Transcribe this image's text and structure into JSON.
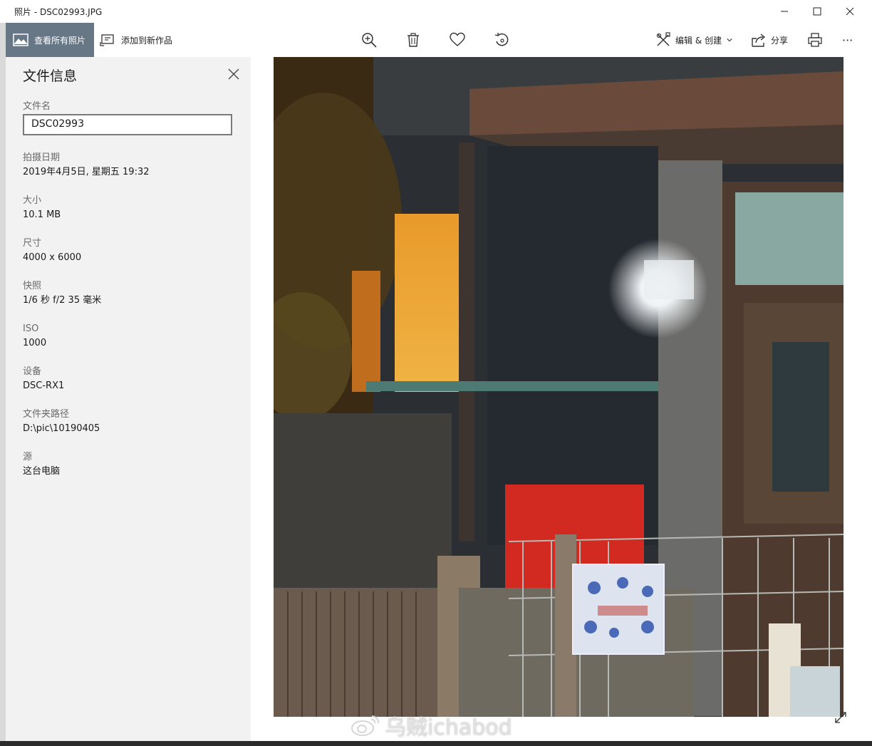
{
  "window": {
    "title": "照片 - DSC02993.JPG",
    "minimize_icon": "minimize-icon",
    "maximize_icon": "maximize-icon",
    "close_icon": "close-icon"
  },
  "toolbar": {
    "view_all_label": "查看所有照片",
    "add_to_creation_label": "添加到新作品",
    "zoom_icon": "zoom-in-icon",
    "delete_icon": "trash-icon",
    "favorite_icon": "heart-icon",
    "rotate_icon": "rotate-icon",
    "edit_create_label": "编辑 & 创建",
    "share_label": "分享",
    "print_icon": "print-icon",
    "more_label": "···",
    "accent_color": "#687786"
  },
  "info_panel": {
    "title": "文件信息",
    "filename_label": "文件名",
    "filename_value": "DSC02993",
    "fields": [
      {
        "label": "拍摄日期",
        "value": "2019年4月5日, 星期五 19:32"
      },
      {
        "label": "大小",
        "value": "10.1 MB"
      },
      {
        "label": "尺寸",
        "value": "4000 x 6000"
      },
      {
        "label": "快照",
        "value": "1/6 秒 f/2 35 毫米"
      },
      {
        "label": "ISO",
        "value": "1000"
      },
      {
        "label": "设备",
        "value": "DSC-RX1"
      },
      {
        "label": "文件夹路径",
        "value": "D:\\pic\\10190405"
      },
      {
        "label": "源",
        "value": "这台电脑"
      }
    ]
  },
  "photo": {
    "description_icon": "photo-image",
    "expand_icon": "fullscreen-icon"
  },
  "watermark": {
    "text": "乌贼ichabod"
  }
}
